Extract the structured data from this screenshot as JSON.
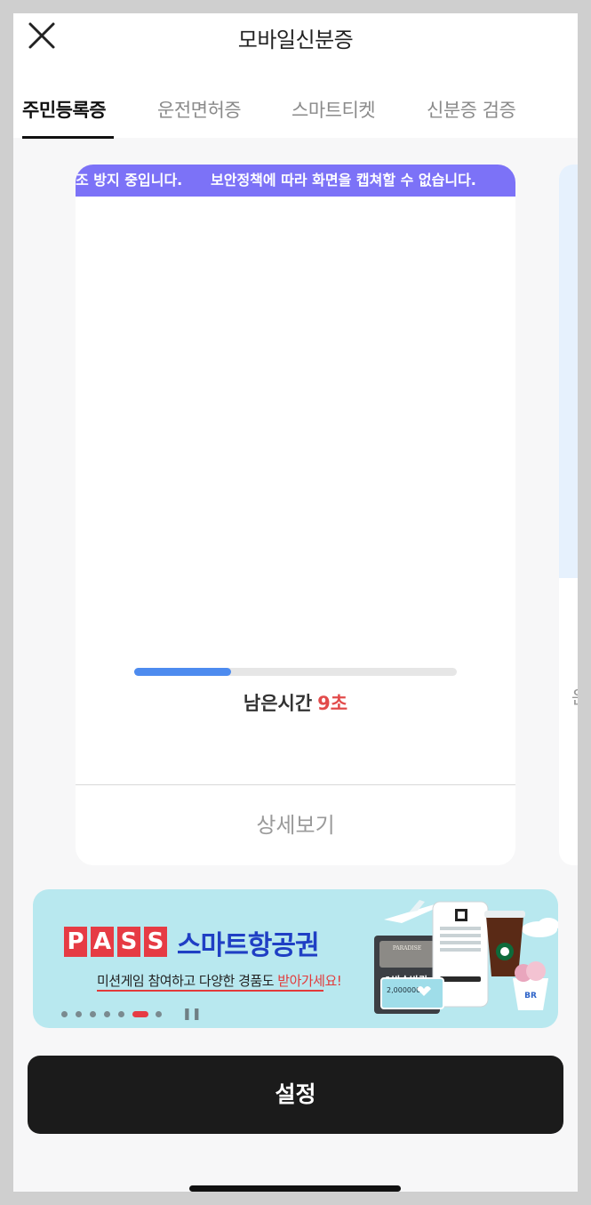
{
  "header": {
    "title": "모바일신분증"
  },
  "tabs": [
    {
      "label": "주민등록증",
      "active": true
    },
    {
      "label": "운전면허증",
      "active": false
    },
    {
      "label": "스마트티켓",
      "active": false
    },
    {
      "label": "신분증 검증",
      "active": false
    }
  ],
  "card": {
    "banner_text_1": "조 방지 중입니다.",
    "banner_text_2": "보안정책에 따라 화면을 캡쳐할 수 없습니다.",
    "remaining_label": "남은시간",
    "remaining_value": "9초",
    "progress_fraction": 0.3,
    "detail_label": "상세보기"
  },
  "peek_card": {
    "label": "운"
  },
  "ad": {
    "brand_letters": [
      "P",
      "A",
      "S",
      "S"
    ],
    "title": "스마트항공권",
    "subtitle_prefix": "미션게임 참여하고 다양한 경품도 ",
    "subtitle_highlight": "받아가세요!",
    "art_texts": {
      "hotel": "PARADISE",
      "ticket": "1박숙박권",
      "amount": "2,000000"
    },
    "dots_total": 7,
    "dots_active_index": 5
  },
  "settings_label": "설정",
  "colors": {
    "accent_banner": "#7c72f7",
    "progress": "#4d8bef",
    "seconds_red": "#e24b4b",
    "ad_background": "#b8e8ef",
    "pass_red": "#e63b44",
    "ad_title_blue": "#1f3fc4"
  }
}
